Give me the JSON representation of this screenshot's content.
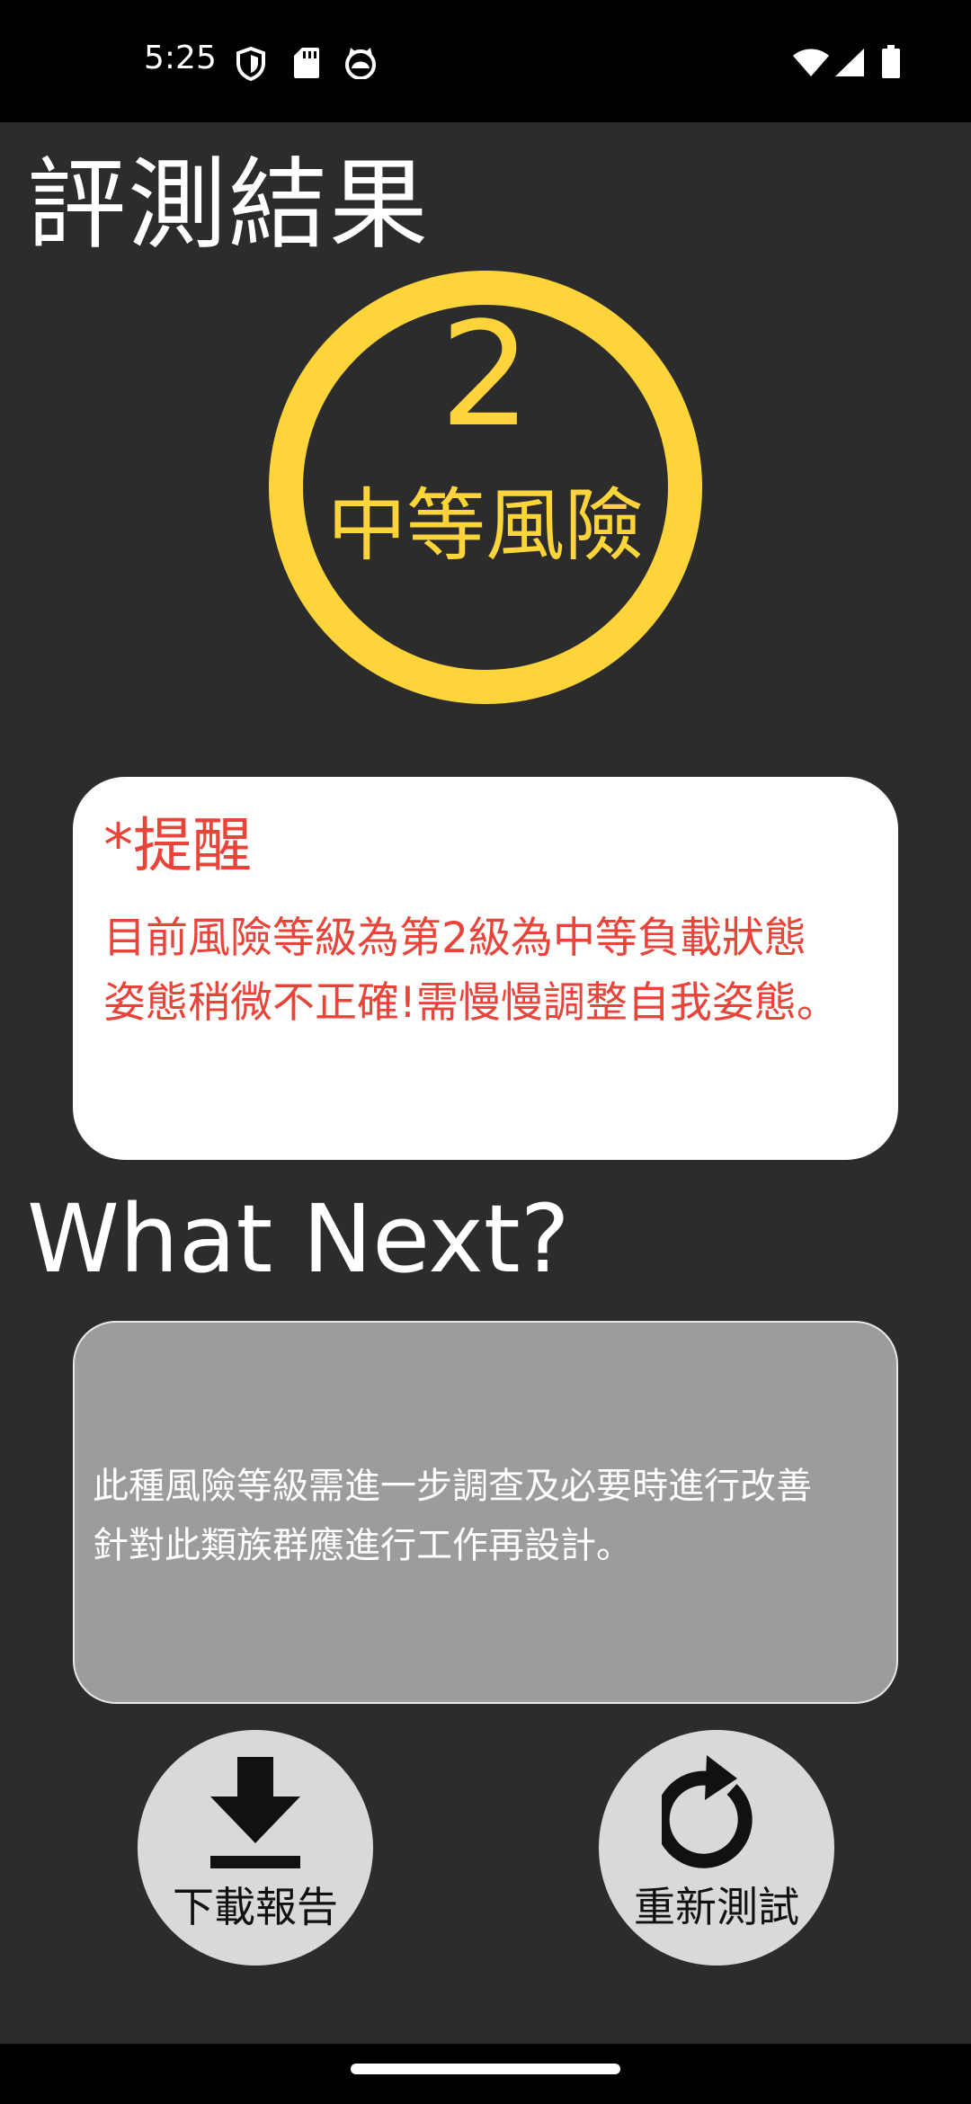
{
  "status_bar": {
    "time": "5:25",
    "icons_left": [
      "shield-icon",
      "sd-card-icon",
      "cat-face-icon"
    ],
    "icons_right": [
      "wifi-icon",
      "signal-icon",
      "battery-icon"
    ]
  },
  "page": {
    "title": "評測結果"
  },
  "risk": {
    "level": "2",
    "label": "中等風險",
    "color": "#fdd53a"
  },
  "reminder": {
    "title": "*提醒",
    "lines": [
      "目前風險等級為第2級為中等負載狀態",
      "姿態稍微不正確!需慢慢調整自我姿態。"
    ],
    "color": "#e8443a"
  },
  "next": {
    "heading": "What Next?",
    "advice_lines": [
      "此種風險等級需進一步調查及必要時進行改善",
      "針對此類族群應進行工作再設計。"
    ]
  },
  "actions": {
    "download": {
      "label": "下載報告",
      "icon": "download-icon"
    },
    "retest": {
      "label": "重新測試",
      "icon": "refresh-icon"
    }
  },
  "colors": {
    "background": "#2c2c2c",
    "accent": "#fdd53a",
    "warning": "#e8443a",
    "advice_card": "#9c9c9c",
    "button": "#d9d9d9"
  }
}
